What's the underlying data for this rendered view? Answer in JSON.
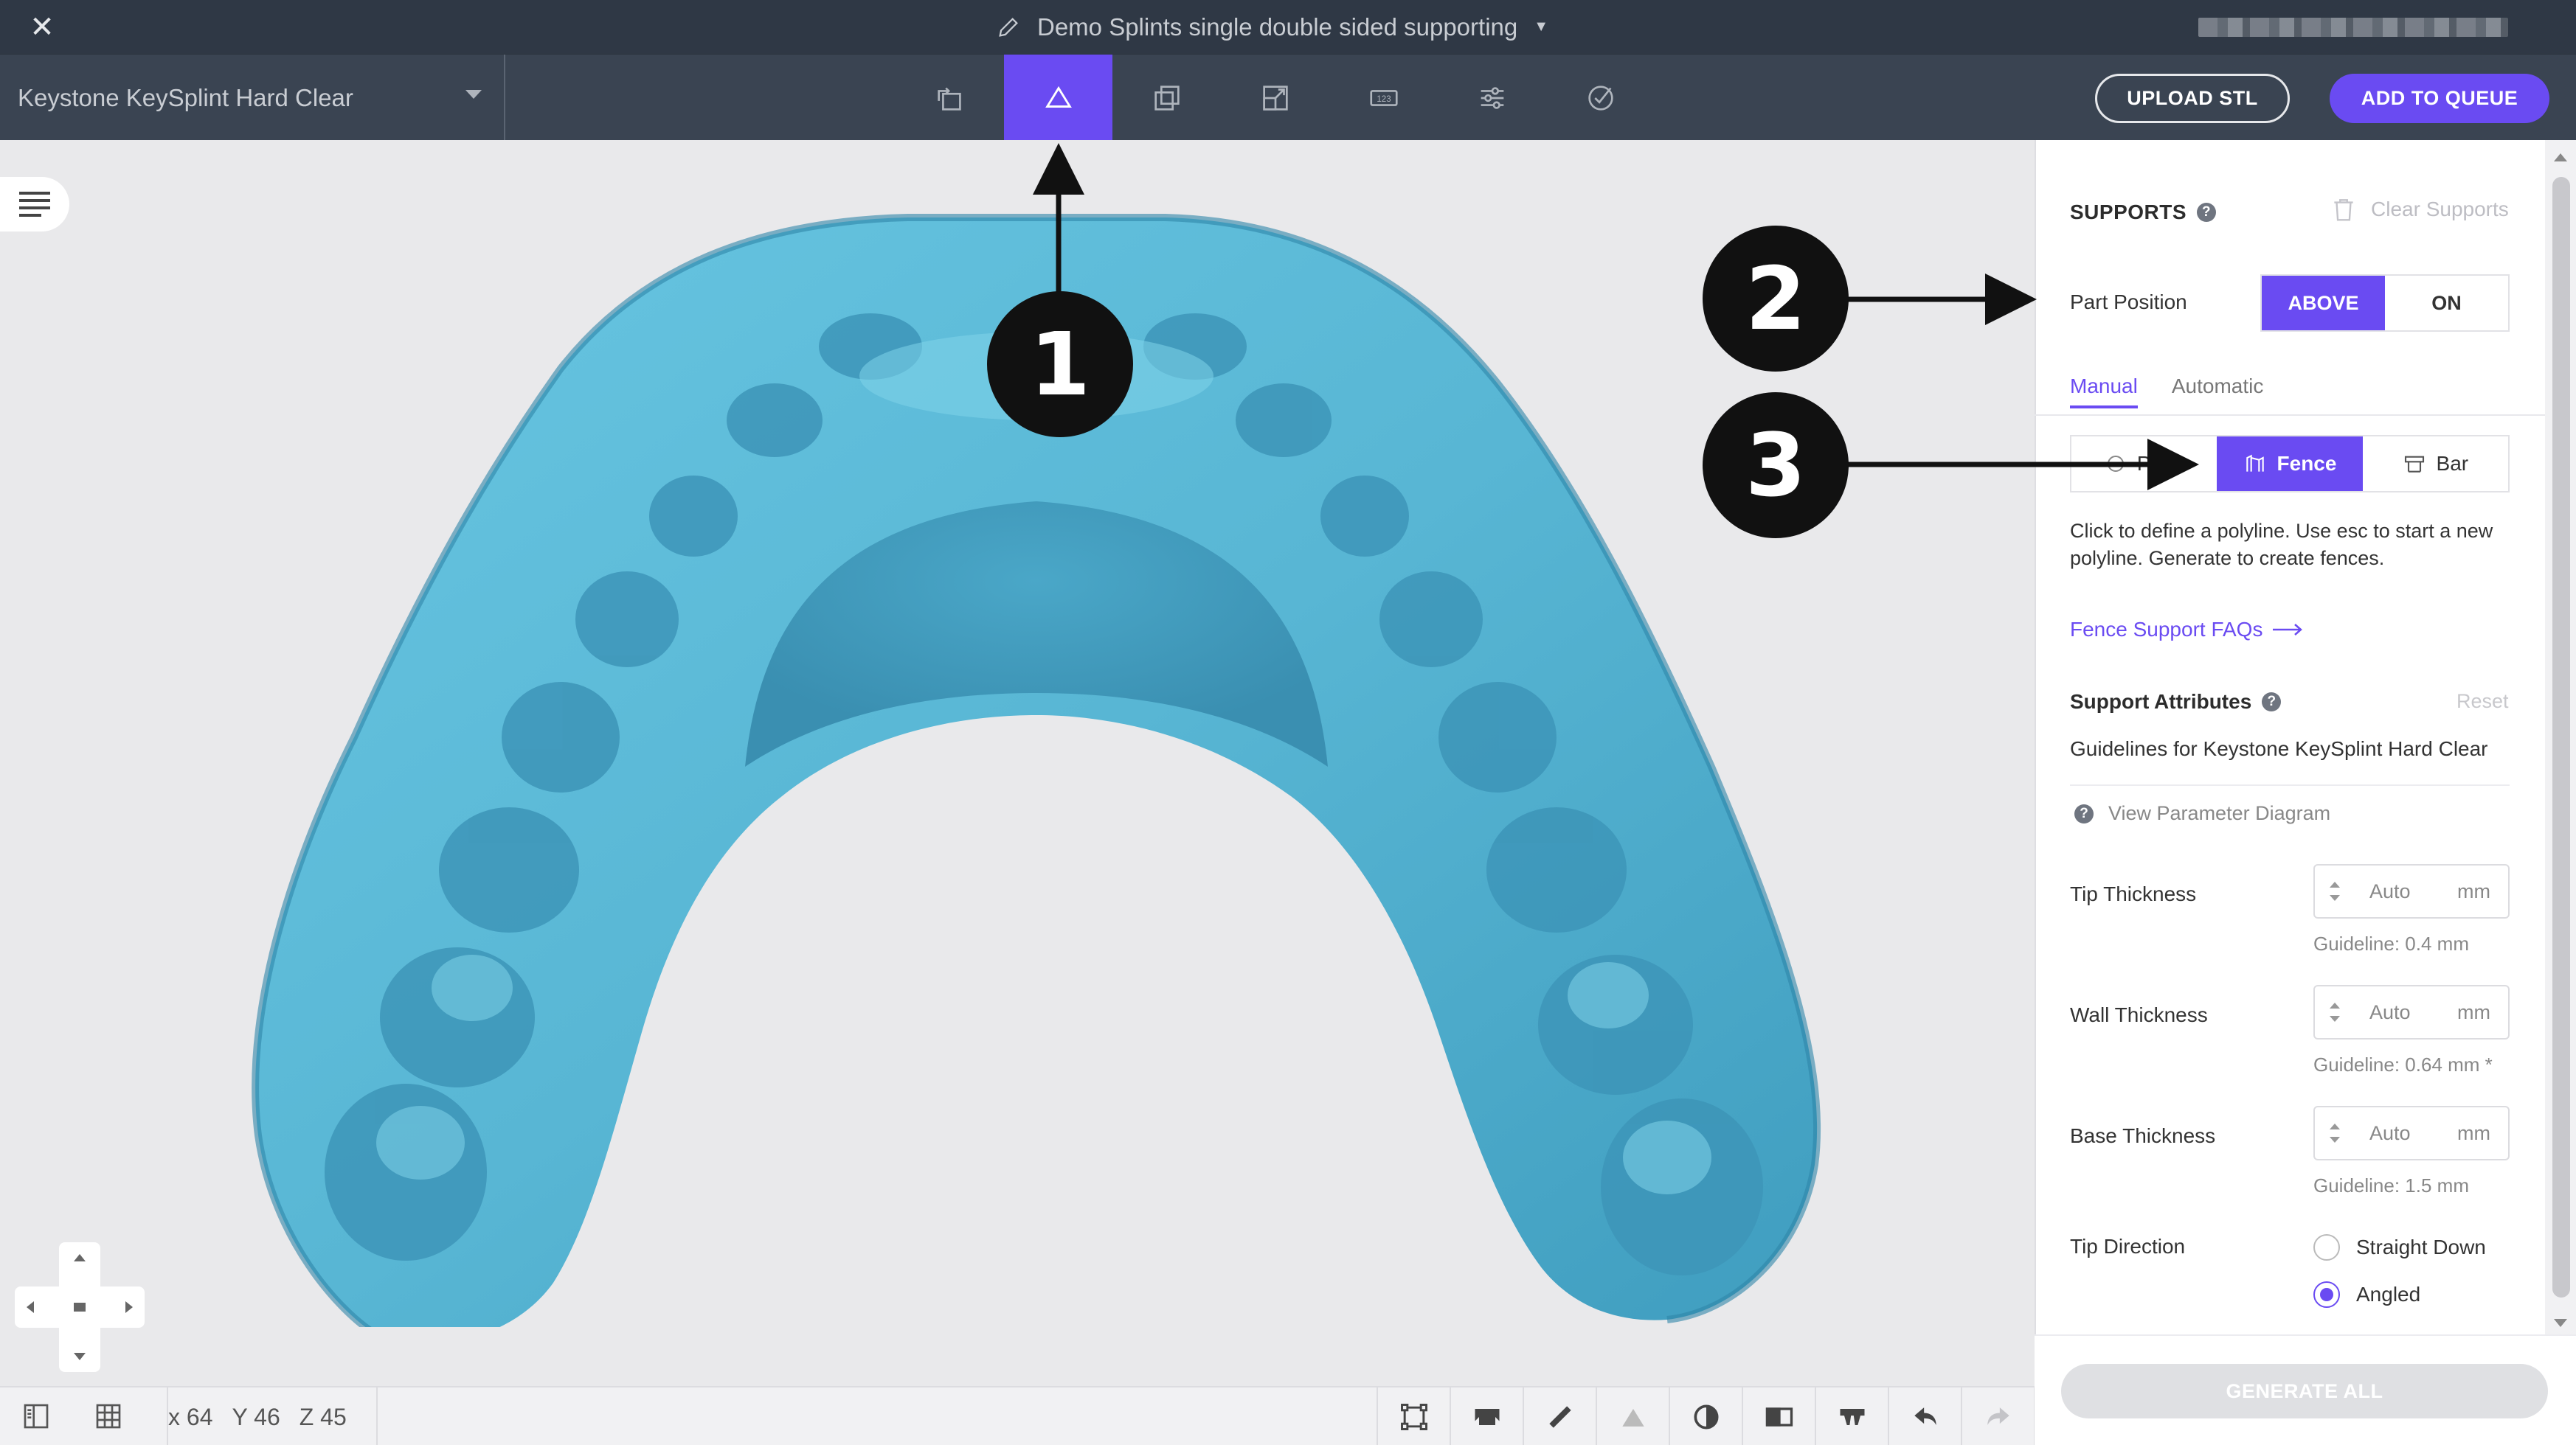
{
  "window": {
    "document_title": "Demo Splints single double sided supporting"
  },
  "toolbar": {
    "material": "Keystone KeySplint Hard Clear",
    "upload_label": "UPLOAD STL",
    "queue_label": "ADD TO QUEUE",
    "tools": [
      "orient-icon",
      "supports-icon",
      "duplicate-icon",
      "scale-icon",
      "label-icon",
      "settings-icon",
      "check-icon"
    ],
    "active_tool": "supports-icon"
  },
  "annotations": [
    "1",
    "2",
    "3"
  ],
  "statusbar": {
    "x": "x 64",
    "y": "Y 46",
    "z": "Z 45"
  },
  "panel": {
    "title": "SUPPORTS",
    "clear_label": "Clear Supports",
    "part_position_label": "Part Position",
    "position_options": [
      "ABOVE",
      "ON"
    ],
    "position_selected": "ABOVE",
    "tabs": [
      "Manual",
      "Automatic"
    ],
    "tab_selected": "Manual",
    "support_types": [
      "Point",
      "Fence",
      "Bar"
    ],
    "support_type_selected": "Fence",
    "help_text": "Click to define a polyline. Use esc to start a new polyline. Generate to create fences.",
    "faq_link": "Fence Support FAQs",
    "attributes_title": "Support Attributes",
    "reset_label": "Reset",
    "guidelines_text": "Guidelines for Keystone KeySplint Hard Clear",
    "diagram_link": "View Parameter Diagram",
    "fields": [
      {
        "label": "Tip Thickness",
        "value": "Auto",
        "unit": "mm",
        "guideline": "Guideline: 0.4 mm"
      },
      {
        "label": "Wall Thickness",
        "value": "Auto",
        "unit": "mm",
        "guideline": "Guideline: 0.64 mm *"
      },
      {
        "label": "Base Thickness",
        "value": "Auto",
        "unit": "mm",
        "guideline": "Guideline: 1.5 mm"
      }
    ],
    "tip_direction_label": "Tip Direction",
    "tip_direction_options": [
      "Straight Down",
      "Angled"
    ],
    "tip_direction_selected": "Angled",
    "generate_label": "GENERATE ALL"
  },
  "colors": {
    "accent": "#6a4bf2",
    "titlebar": "#2f3845",
    "toolbar": "#3a4452",
    "model": "#5bbad7"
  }
}
